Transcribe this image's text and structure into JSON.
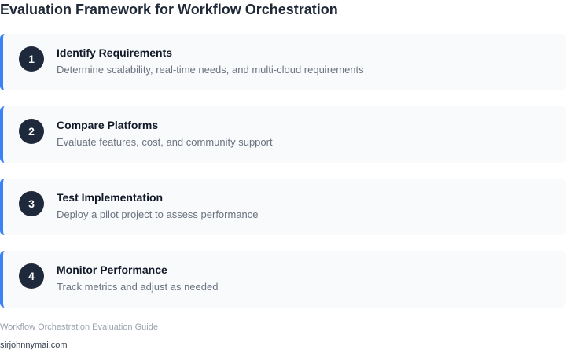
{
  "title": "Evaluation Framework for Workflow Orchestration",
  "steps": [
    {
      "number": "1",
      "heading": "Identify Requirements",
      "description": "Determine scalability, real-time needs, and multi-cloud requirements"
    },
    {
      "number": "2",
      "heading": "Compare Platforms",
      "description": "Evaluate features, cost, and community support"
    },
    {
      "number": "3",
      "heading": "Test Implementation",
      "description": "Deploy a pilot project to assess performance"
    },
    {
      "number": "4",
      "heading": "Monitor Performance",
      "description": "Track metrics and adjust as needed"
    }
  ],
  "footer": {
    "caption": "Workflow Orchestration Evaluation Guide",
    "site": "sirjohnnymai.com"
  },
  "colors": {
    "accent": "#3b82f6",
    "badge": "#1e293b",
    "card_background": "#f8fafc"
  }
}
